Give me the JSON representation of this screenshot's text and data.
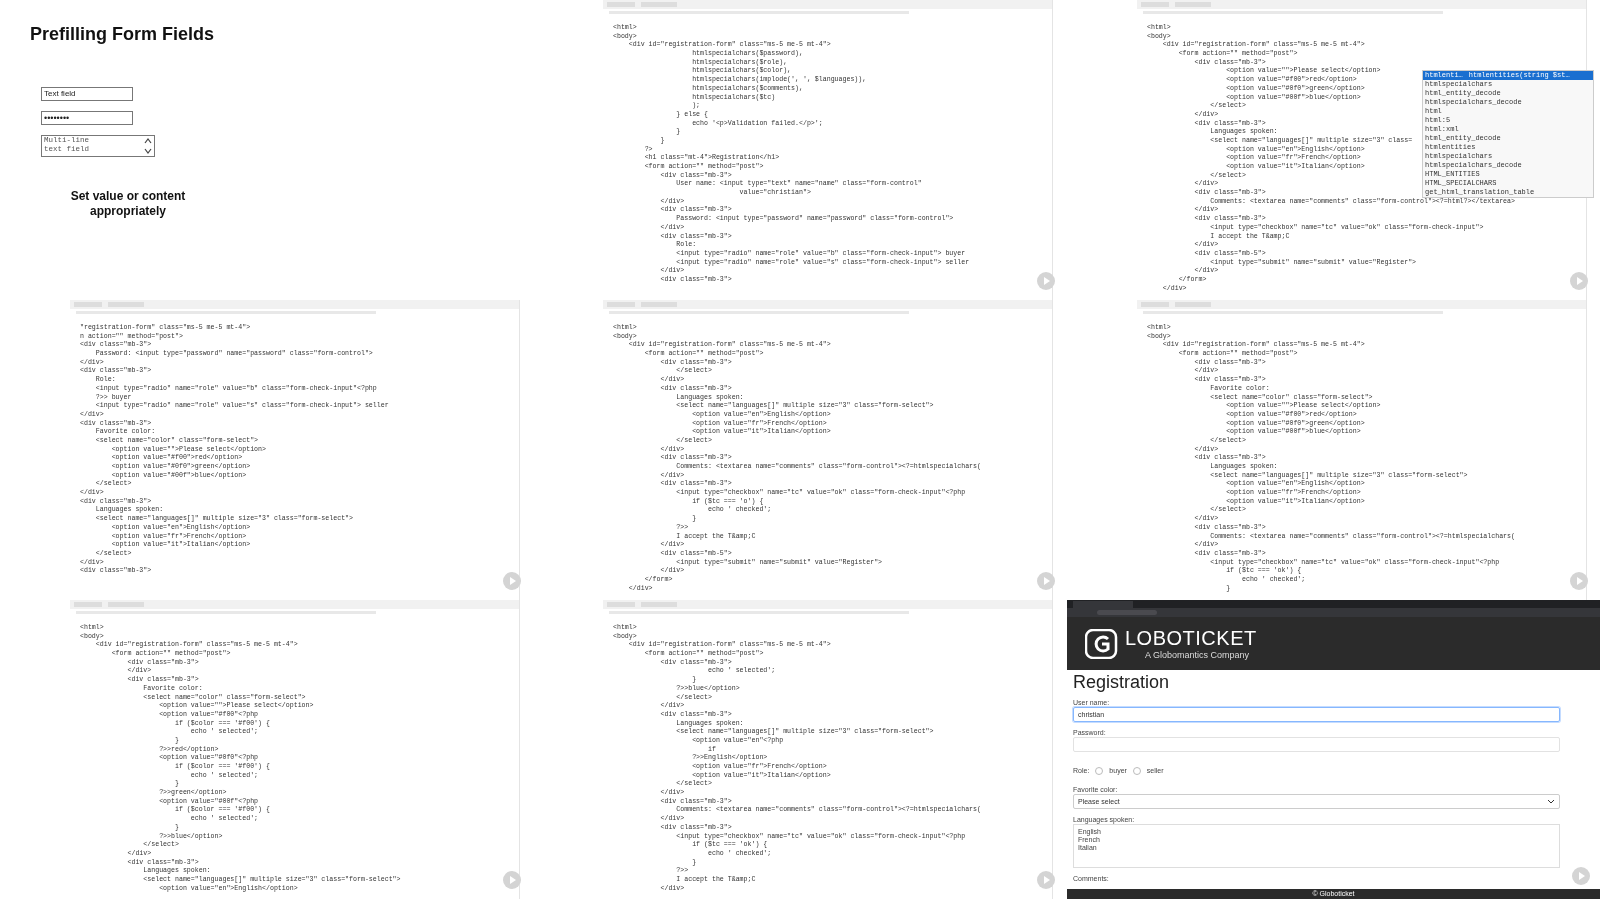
{
  "slide": {
    "title": "Prefilling Form Fields",
    "fields": [
      {
        "kind": "text",
        "value": "Text field"
      },
      {
        "kind": "password",
        "value": "••••••••"
      },
      {
        "kind": "textarea",
        "value": "Multi-line text field"
      }
    ],
    "caption": "Set value or content appropriately"
  },
  "editors": [
    {
      "lines": [
        "<html>",
        "<body>",
        "    <div id=\"registration-form\" class=\"ms-5 me-5 mt-4\">",
        "                    htmlspecialchars($password),",
        "                    htmlspecialchars($role),",
        "                    htmlspecialchars($color),",
        "                    htmlspecialchars(implode(', ', $languages)),",
        "                    htmlspecialchars($comments),",
        "                    htmlspecialchars($tc)",
        "                    );",
        "                } else {",
        "                    echo '<p>Validation failed.</p>';",
        "                }",
        "            }",
        "        ?>",
        "        <h1 class=\"mt-4\">Registration</h1>",
        "        <form action=\"\" method=\"post\">",
        "            <div class=\"mb-3\">",
        "                User name: <input type=\"text\" name=\"name\" class=\"form-control\"",
        "                                value=\"christian\">",
        "            </div>",
        "            <div class=\"mb-3\">",
        "                Password: <input type=\"password\" name=\"password\" class=\"form-control\">",
        "            </div>",
        "            <div class=\"mb-3\">",
        "                Role:",
        "                <input type=\"radio\" name=\"role\" value=\"b\" class=\"form-check-input\"> buyer",
        "                <input type=\"radio\" name=\"role\" value=\"s\" class=\"form-check-input\"> seller",
        "            </div>",
        "            <div class=\"mb-3\">"
      ]
    },
    {
      "lines": [
        "<html>",
        "<body>",
        "    <div id=\"registration-form\" class=\"ms-5 me-5 mt-4\">",
        "        <form action=\"\" method=\"post\">",
        "            <div class=\"mb-3\">",
        "                    <option value=\"\">Please select</option>",
        "                    <option value=\"#f00\">red</option>",
        "                    <option value=\"#0f0\">green</option>",
        "                    <option value=\"#00f\">blue</option>",
        "                </select>",
        "            </div>",
        "            <div class=\"mb-3\">",
        "                Languages spoken:",
        "                <select name=\"languages[]\" multiple size=\"3\" class=",
        "                    <option value=\"en\">English</option>",
        "                    <option value=\"fr\">French</option>",
        "                    <option value=\"it\">Italian</option>",
        "                </select>",
        "            </div>",
        "            <div class=\"mb-3\">",
        "                Comments: <textarea name=\"comments\" class=\"form-control\"><?=html?></textarea>",
        "            </div>",
        "            <div class=\"mb-3\">",
        "                <input type=\"checkbox\" name=\"tc\" value=\"ok\" class=\"form-check-input\">",
        "                I accept the T&amp;C",
        "            </div>",
        "            <div class=\"mb-5\">",
        "                <input type=\"submit\" name=\"submit\" value=\"Register\">",
        "            </div>",
        "        </form>",
        "    </div>"
      ],
      "autocomplete": {
        "items": [
          {
            "label": "htmlenti…",
            "detail": "htmlentities(string $st…",
            "selected": true
          },
          {
            "label": "htmlspecialchars",
            "selected": false
          },
          {
            "label": "html_entity_decode",
            "selected": false
          },
          {
            "label": "htmlspecialchars_decode",
            "selected": false
          },
          {
            "label": "html",
            "selected": false
          },
          {
            "label": "html:5",
            "selected": false
          },
          {
            "label": "html:xml",
            "selected": false
          },
          {
            "label": "html_entity_decode",
            "selected": false
          },
          {
            "label": "htmlentities",
            "selected": false
          },
          {
            "label": "htmlspecialchars",
            "selected": false
          },
          {
            "label": "htmlspecialchars_decode",
            "selected": false
          },
          {
            "label": "HTML_ENTITIES",
            "selected": false
          },
          {
            "label": "HTML_SPECIALCHARS",
            "selected": false
          },
          {
            "label": "get_html_translation_table",
            "selected": false
          }
        ]
      }
    },
    {
      "lines": [
        "\"registration-form\" class=\"ms-5 me-5 mt-4\">",
        "n action=\"\" method=\"post\">",
        "<div class=\"mb-3\">",
        "    Password: <input type=\"password\" name=\"password\" class=\"form-control\">",
        "</div>",
        "<div class=\"mb-3\">",
        "    Role:",
        "    <input type=\"radio\" name=\"role\" value=\"b\" class=\"form-check-input\"<?php",
        "    ?>> buyer",
        "    <input type=\"radio\" name=\"role\" value=\"s\" class=\"form-check-input\"> seller",
        "</div>",
        "<div class=\"mb-3\">",
        "    Favorite color:",
        "    <select name=\"color\" class=\"form-select\">",
        "        <option value=\"\">Please select</option>",
        "        <option value=\"#f00\">red</option>",
        "        <option value=\"#0f0\">green</option>",
        "        <option value=\"#00f\">blue</option>",
        "    </select>",
        "</div>",
        "<div class=\"mb-3\">",
        "    Languages spoken:",
        "    <select name=\"languages[]\" multiple size=\"3\" class=\"form-select\">",
        "        <option value=\"en\">English</option>",
        "        <option value=\"fr\">French</option>",
        "        <option value=\"it\">Italian</option>",
        "    </select>",
        "</div>",
        "<div class=\"mb-3\">"
      ]
    },
    {
      "lines": [
        "<html>",
        "<body>",
        "    <div id=\"registration-form\" class=\"ms-5 me-5 mt-4\">",
        "        <form action=\"\" method=\"post\">",
        "            <div class=\"mb-3\">",
        "                </select>",
        "            </div>",
        "            <div class=\"mb-3\">",
        "                Languages spoken:",
        "                <select name=\"languages[]\" multiple size=\"3\" class=\"form-select\">",
        "                    <option value=\"en\">English</option>",
        "                    <option value=\"fr\">French</option>",
        "                    <option value=\"it\">Italian</option>",
        "                </select>",
        "            </div>",
        "            <div class=\"mb-3\">",
        "                Comments: <textarea name=\"comments\" class=\"form-control\"><?=htmlspecialchars(",
        "            </div>",
        "            <div class=\"mb-3\">",
        "                <input type=\"checkbox\" name=\"tc\" value=\"ok\" class=\"form-check-input\"<?php",
        "                    if ($tc === 'o') {",
        "                        echo ' checked';",
        "                    }",
        "                ?>>",
        "                I accept the T&amp;C",
        "            </div>",
        "            <div class=\"mb-5\">",
        "                <input type=\"submit\" name=\"submit\" value=\"Register\">",
        "            </div>",
        "        </form>",
        "    </div>"
      ]
    },
    {
      "lines": [
        "<html>",
        "<body>",
        "    <div id=\"registration-form\" class=\"ms-5 me-5 mt-4\">",
        "        <form action=\"\" method=\"post\">",
        "            <div class=\"mb-3\">",
        "            </div>",
        "            <div class=\"mb-3\">",
        "                Favorite color:",
        "                <select name=\"color\" class=\"form-select\">",
        "                    <option value=\"\">Please select</option>",
        "                    <option value=\"#f00\">red</option>",
        "                    <option value=\"#0f0\">green</option>",
        "                    <option value=\"#00f\">blue</option>",
        "                </select>",
        "            </div>",
        "            <div class=\"mb-3\">",
        "                Languages spoken:",
        "                <select name=\"languages[]\" multiple size=\"3\" class=\"form-select\">",
        "                    <option value=\"en\">English</option>",
        "                    <option value=\"fr\">French</option>",
        "                    <option value=\"it\">Italian</option>",
        "                </select>",
        "            </div>",
        "            <div class=\"mb-3\">",
        "                Comments: <textarea name=\"comments\" class=\"form-control\"><?=htmlspecialchars(",
        "            </div>",
        "            <div class=\"mb-3\">",
        "                <input type=\"checkbox\" name=\"tc\" value=\"ok\" class=\"form-check-input\"<?php",
        "                    if ($tc === 'ok') {",
        "                        echo ' checked';",
        "                    }"
      ]
    },
    {
      "lines": [
        "<html>",
        "<body>",
        "    <div id=\"registration-form\" class=\"ms-5 me-5 mt-4\">",
        "        <form action=\"\" method=\"post\">",
        "            <div class=\"mb-3\">",
        "            </div>",
        "            <div class=\"mb-3\">",
        "                Favorite color:",
        "                <select name=\"color\" class=\"form-select\">",
        "                    <option value=\"\">Please select</option>",
        "                    <option value=\"#f00\"<?php",
        "                        if ($color === '#f00') {",
        "                            echo ' selected';",
        "                        }",
        "                    ?>>red</option>",
        "                    <option value=\"#0f0\"<?php",
        "                        if ($color === '#f00') {",
        "                            echo ' selected';",
        "                        }",
        "                    ?>>green</option>",
        "                    <option value=\"#00f\"<?php",
        "                        if ($color === '#f00') {",
        "                            echo ' selected';",
        "                        }",
        "                    ?>>blue</option>",
        "                </select>",
        "            </div>",
        "            <div class=\"mb-3\">",
        "                Languages spoken:",
        "                <select name=\"languages[]\" multiple size=\"3\" class=\"form-select\">",
        "                    <option value=\"en\">English</option>"
      ]
    },
    {
      "lines": [
        "<html>",
        "<body>",
        "    <div id=\"registration-form\" class=\"ms-5 me-5 mt-4\">",
        "        <form action=\"\" method=\"post\">",
        "            <div class=\"mb-3\">",
        "                        echo ' selected';",
        "                    }",
        "                ?>>blue</option>",
        "                </select>",
        "            </div>",
        "            <div class=\"mb-3\">",
        "                Languages spoken:",
        "                <select name=\"languages[]\" multiple size=\"3\" class=\"form-select\">",
        "                    <option value=\"en\"<?php",
        "                        if",
        "                    ?>>English</option>",
        "                    <option value=\"fr\">French</option>",
        "                    <option value=\"it\">Italian</option>",
        "                </select>",
        "            </div>",
        "            <div class=\"mb-3\">",
        "                Comments: <textarea name=\"comments\" class=\"form-control\"><?=htmlspecialchars(",
        "            </div>",
        "            <div class=\"mb-3\">",
        "                <input type=\"checkbox\" name=\"tc\" value=\"ok\" class=\"form-check-input\"<?php",
        "                    if ($tc === 'ok') {",
        "                        echo ' checked';",
        "                    }",
        "                ?>>",
        "                I accept the T&amp;C",
        "            </div>"
      ]
    }
  ],
  "browser": {
    "brand": "LOBOTICKET",
    "tagline": "A Globomantics Company",
    "heading": "Registration",
    "fields": [
      {
        "kind": "text",
        "label": "User name:",
        "value": "christian"
      },
      {
        "kind": "password",
        "label": "Password:"
      },
      {
        "kind": "radio",
        "label": "Role:",
        "options": [
          {
            "label": "buyer",
            "selected": false
          },
          {
            "label": "seller",
            "selected": false
          }
        ]
      },
      {
        "kind": "select",
        "label": "Favorite color:",
        "value": "Please select"
      },
      {
        "kind": "multiselect",
        "label": "Languages spoken:",
        "options": [
          "English",
          "French",
          "Italian"
        ]
      },
      {
        "kind": "textarea",
        "label": "Comments:"
      }
    ],
    "footer": "© Globoticket"
  }
}
